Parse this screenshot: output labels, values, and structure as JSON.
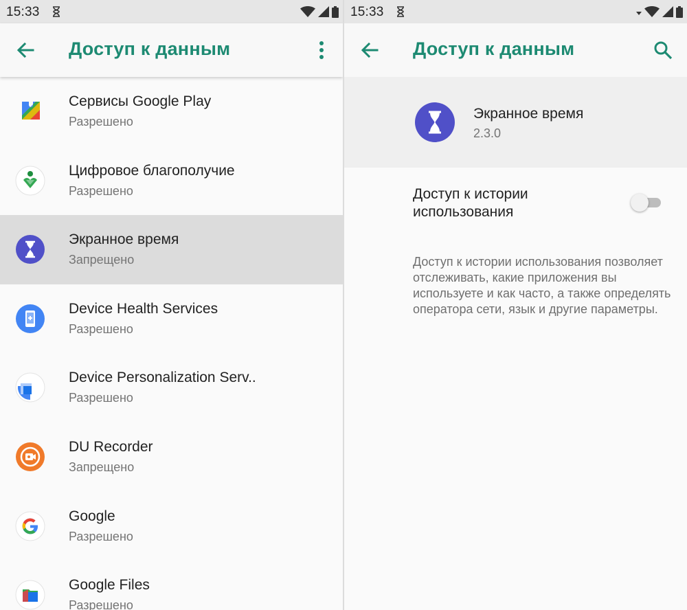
{
  "left_screen": {
    "status_bar": {
      "time": "15:33"
    },
    "app_bar": {
      "title": "Доступ к данным"
    },
    "apps": [
      {
        "name": "Сервисы Google Play",
        "status": "Разрешено",
        "icon": "google-play-services-icon",
        "selected": false
      },
      {
        "name": "Цифровое благополучие",
        "status": "Разрешено",
        "icon": "digital-wellbeing-icon",
        "selected": false
      },
      {
        "name": "Экранное время",
        "status": "Запрещено",
        "icon": "hourglass-app-icon",
        "selected": true
      },
      {
        "name": "Device Health Services",
        "status": "Разрешено",
        "icon": "device-health-icon",
        "selected": false
      },
      {
        "name": "Device Personalization Serv..",
        "status": "Разрешено",
        "icon": "device-personalization-icon",
        "selected": false
      },
      {
        "name": "DU Recorder",
        "status": "Запрещено",
        "icon": "du-recorder-icon",
        "selected": false
      },
      {
        "name": "Google",
        "status": "Разрешено",
        "icon": "google-icon",
        "selected": false
      },
      {
        "name": "Google Files",
        "status": "Разрешено",
        "icon": "google-files-icon",
        "selected": false
      }
    ]
  },
  "right_screen": {
    "status_bar": {
      "time": "15:33"
    },
    "app_bar": {
      "title": "Доступ к данным"
    },
    "app_header": {
      "name": "Экранное время",
      "version": "2.3.0"
    },
    "setting": {
      "label": "Доступ к истории использования",
      "enabled": false,
      "description": "Доступ к истории использования позволяет отслеживать, какие приложения вы используете и как часто, а также определять оператора сети, язык и другие параметры."
    }
  },
  "colors": {
    "accent": "#1d8a72",
    "hourglass_app": "#5050c8",
    "selected_row": "#dcdcdc"
  }
}
